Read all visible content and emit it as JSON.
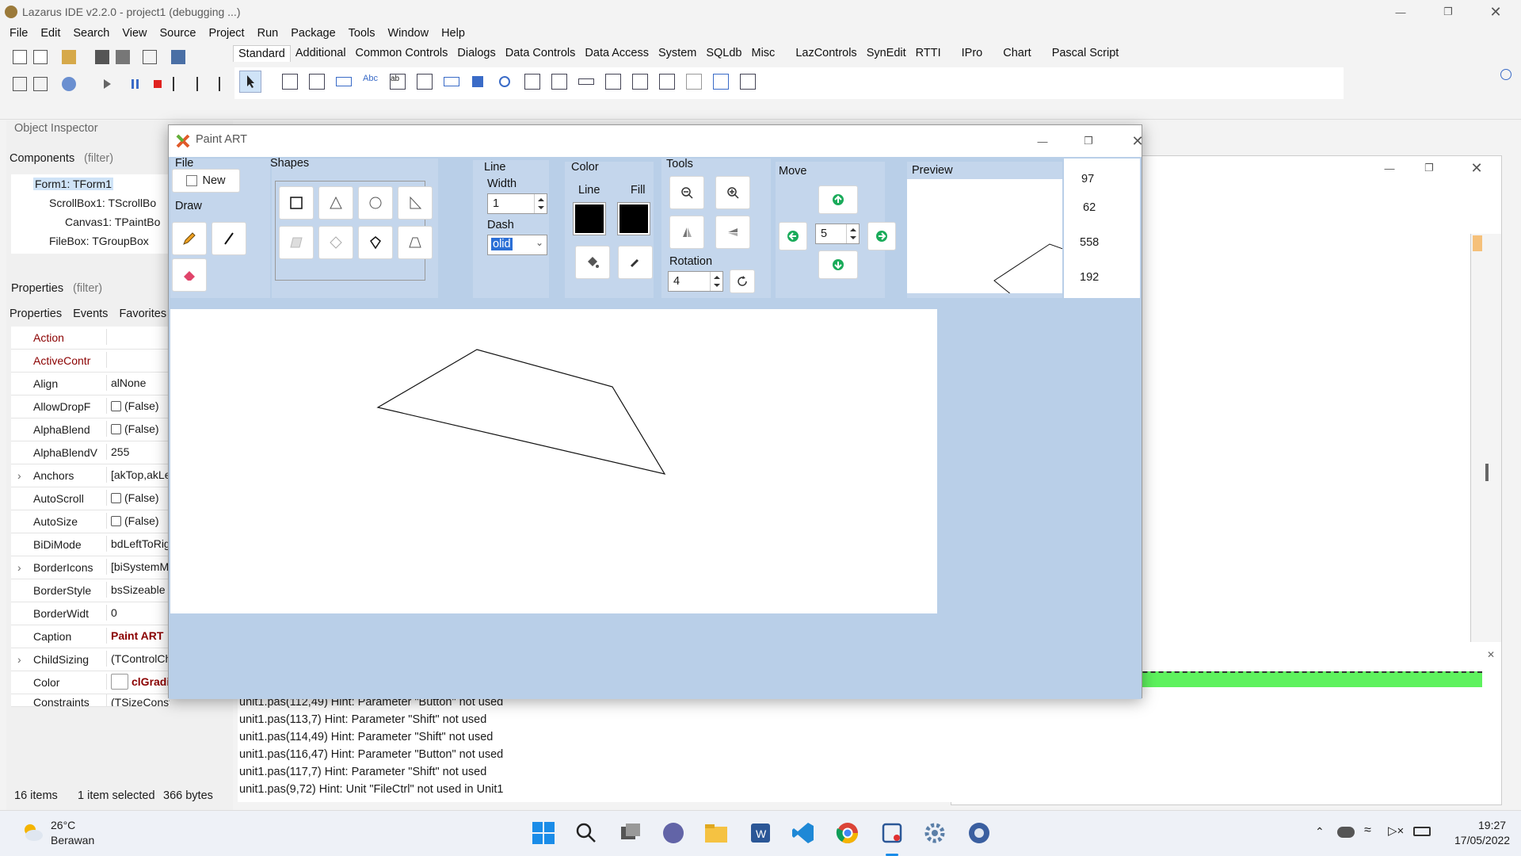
{
  "ide": {
    "title": "Lazarus IDE v2.2.0 - project1 (debugging ...)",
    "menu": [
      "File",
      "Edit",
      "Search",
      "View",
      "Source",
      "Project",
      "Run",
      "Package",
      "Tools",
      "Window",
      "Help"
    ],
    "palette_tabs": [
      "Standard",
      "Additional",
      "Common Controls",
      "Dialogs",
      "Data Controls",
      "Data Access",
      "System",
      "SQLdb",
      "Misc",
      "LazControls",
      "SynEdit",
      "RTTI",
      "IPro",
      "Chart",
      "Pascal Script"
    ]
  },
  "object_inspector": {
    "title": "Object Inspector",
    "components_label": "Components",
    "filter_placeholder": "(filter)",
    "tree": [
      "Form1: TForm1",
      "ScrollBox1: TScrollBo",
      "Canvas1: TPaintBo",
      "FileBox: TGroupBox"
    ],
    "properties_label": "Properties",
    "tabs": [
      "Properties",
      "Events",
      "Favorites"
    ],
    "rows": [
      {
        "name": "Action",
        "value": ""
      },
      {
        "name": "ActiveContr",
        "value": ""
      },
      {
        "name": "Align",
        "value": "alNone"
      },
      {
        "name": "AllowDropF",
        "value": "(False)",
        "check": true
      },
      {
        "name": "AlphaBlend",
        "value": "(False)",
        "check": true
      },
      {
        "name": "AlphaBlendV",
        "value": "255"
      },
      {
        "name": "Anchors",
        "value": "[akTop,akLef"
      },
      {
        "name": "AutoScroll",
        "value": "(False)",
        "check": true
      },
      {
        "name": "AutoSize",
        "value": "(False)",
        "check": true
      },
      {
        "name": "BiDiMode",
        "value": "bdLeftToRigl"
      },
      {
        "name": "BorderIcons",
        "value": "[biSystemMe"
      },
      {
        "name": "BorderStyle",
        "value": "bsSizeable"
      },
      {
        "name": "BorderWidt",
        "value": "0"
      },
      {
        "name": "Caption",
        "value": "Paint ART"
      },
      {
        "name": "ChildSizing",
        "value": "(TControlChi"
      },
      {
        "name": "Color",
        "value": "clGradie"
      },
      {
        "name": "Constraints",
        "value": "(TSizeConstraints)"
      }
    ],
    "status": {
      "items": "16 items",
      "selected": "1 item selected",
      "size": "366 bytes"
    }
  },
  "messages": [
    "unit1.pas(112,49) Hint: Parameter \"Button\" not used",
    "unit1.pas(113,7) Hint: Parameter \"Shift\" not used",
    "unit1.pas(114,49) Hint: Parameter \"Shift\" not used",
    "unit1.pas(116,47) Hint: Parameter \"Button\" not used",
    "unit1.pas(117,7) Hint: Parameter \"Shift\" not used",
    "unit1.pas(9,72) Hint: Unit \"FileCtrl\" not used in Unit1"
  ],
  "paint": {
    "title": "Paint ART",
    "file_label": "File",
    "new_button": "New",
    "draw_label": "Draw",
    "shapes_label": "Shapes",
    "line_label": "Line",
    "width_label": "Width",
    "width_value": "1",
    "dash_label": "Dash",
    "dash_value": "olid",
    "color_label": "Color",
    "line_color_label": "Line",
    "fill_color_label": "Fill",
    "line_color": "#000000",
    "fill_color": "#000000",
    "tools_label": "Tools",
    "rotation_label": "Rotation",
    "rotation_value": "4",
    "move_label": "Move",
    "move_value": "5",
    "preview_label": "Preview",
    "coords": [
      "97",
      "62",
      "558",
      "192"
    ]
  },
  "taskbar": {
    "temp": "26°C",
    "weather": "Berawan",
    "time": "19:27",
    "date": "17/05/2022"
  }
}
